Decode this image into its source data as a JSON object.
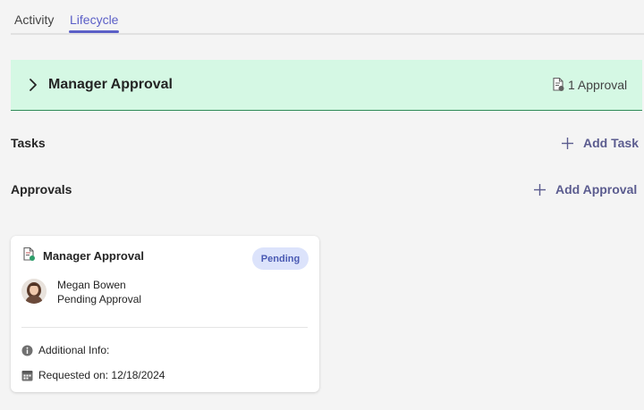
{
  "tabs": [
    {
      "label": "Activity",
      "selected": false
    },
    {
      "label": "Lifecycle",
      "selected": true
    }
  ],
  "stage": {
    "title": "Manager Approval",
    "approval_count": "1 Approval",
    "icons": {
      "expand": "chevron-right-icon",
      "count": "approval-document-icon"
    },
    "background_color": "#d5f8e4"
  },
  "sections": {
    "tasks": {
      "label": "Tasks",
      "add_label": "Add Task",
      "icon": "plus-icon"
    },
    "approvals": {
      "label": "Approvals",
      "add_label": "Add Approval",
      "icon": "plus-icon"
    }
  },
  "approval_card": {
    "title": "Manager Approval",
    "status_badge": "Pending",
    "approver": {
      "name": "Megan Bowen",
      "status": "Pending Approval"
    },
    "additional_info_label": "Additional Info:",
    "requested_on": "Requested on: 12/18/2024",
    "icons": {
      "card": "approval-document-icon",
      "info": "info-icon",
      "calendar": "calendar-icon"
    }
  },
  "colors": {
    "accent": "#5b5fc7",
    "badge_bg": "#dce3fb",
    "badge_text": "#4a5ab3",
    "add_button": "#5b5c8f"
  }
}
